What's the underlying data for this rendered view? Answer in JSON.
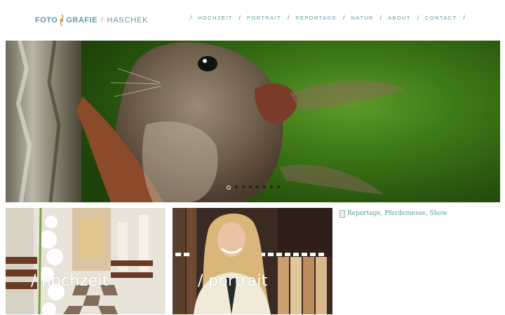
{
  "logo": {
    "part1": "FOTO",
    "part2": "GRAFIE",
    "separator": "/",
    "name": "HASCHEK"
  },
  "nav": {
    "items": [
      {
        "label": "HOCHZEIT"
      },
      {
        "label": "PORTRAIT"
      },
      {
        "label": "REPORTAGE"
      },
      {
        "label": "NATUR"
      },
      {
        "label": "ABOUT"
      },
      {
        "label": "CONTACT"
      }
    ],
    "separator": "/"
  },
  "slider": {
    "image": "squirrel",
    "dot_count": 8,
    "active_dot": 1
  },
  "tiles": [
    {
      "label": "/ hochzeit"
    },
    {
      "label": "/ portrait"
    }
  ],
  "broken_image": {
    "alt": "Reportage, Pferdemesse, Show"
  },
  "colors": {
    "accent": "#5a9aa0",
    "logo_gold": "#c9a24b"
  }
}
